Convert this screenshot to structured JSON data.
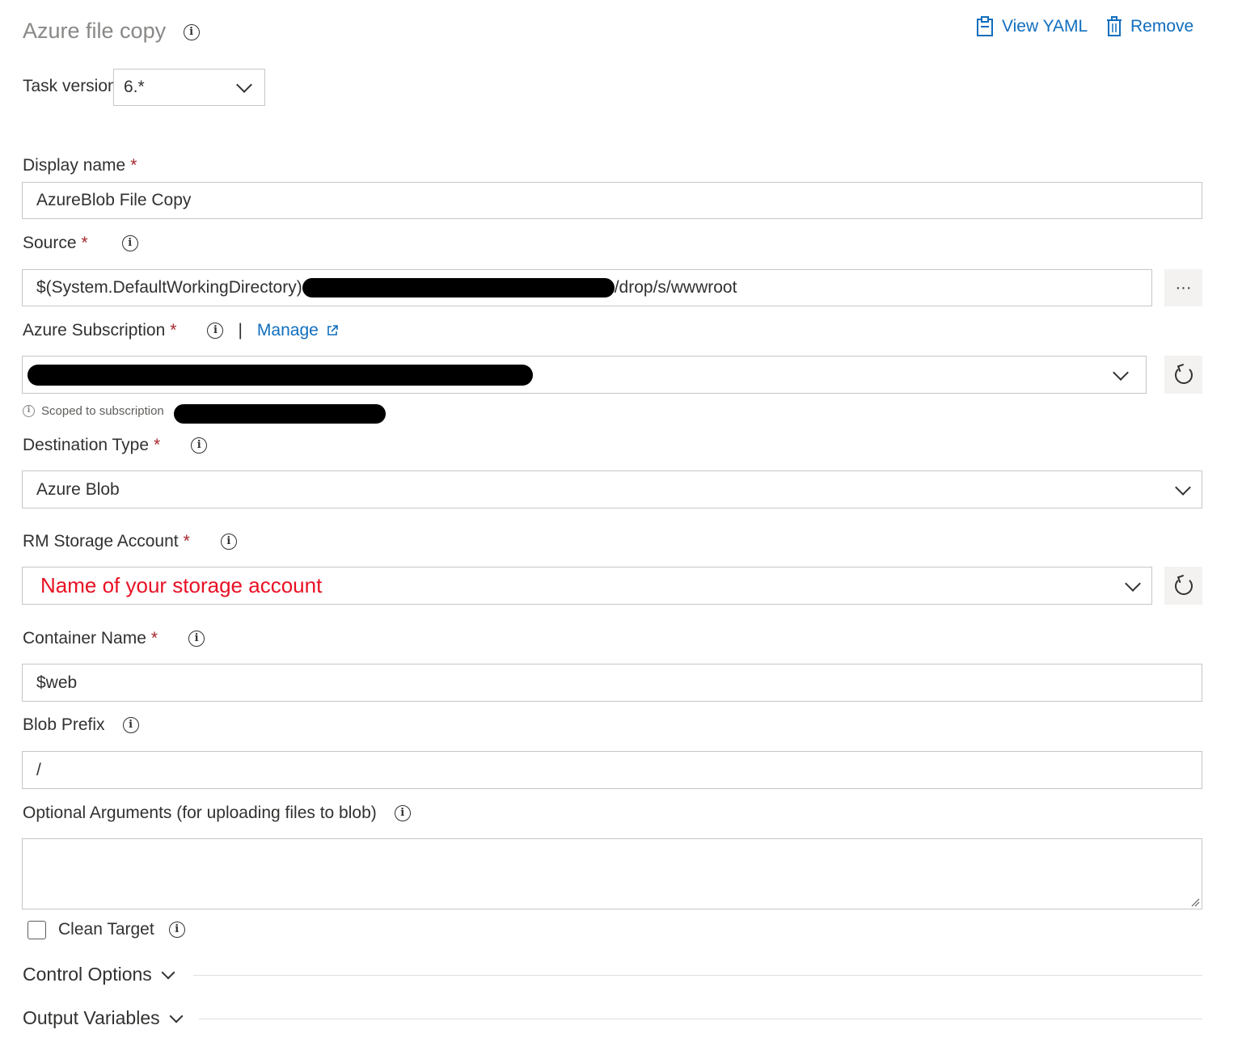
{
  "header": {
    "title": "Azure file copy",
    "view_yaml_label": "View YAML",
    "remove_label": "Remove"
  },
  "task_version": {
    "label": "Task version",
    "value": "6.*"
  },
  "display_name": {
    "label": "Display name",
    "value": "AzureBlob File Copy"
  },
  "source": {
    "label": "Source",
    "value_prefix": "$(System.DefaultWorkingDirectory)",
    "value_suffix": "/drop/s/wwwroot",
    "browse_label": "···"
  },
  "azure_subscription": {
    "label": "Azure Subscription",
    "manage_label": "Manage",
    "separator": "|",
    "scoped_note": "Scoped to subscription"
  },
  "destination_type": {
    "label": "Destination Type",
    "value": "Azure Blob"
  },
  "rm_storage_account": {
    "label": "RM Storage Account",
    "value": "Name of your storage account",
    "value_color": "#e81123"
  },
  "container_name": {
    "label": "Container Name",
    "value": "$web"
  },
  "blob_prefix": {
    "label": "Blob Prefix",
    "value": "/"
  },
  "optional_arguments": {
    "label": "Optional Arguments (for uploading files to blob)",
    "value": ""
  },
  "clean_target": {
    "label": "Clean Target",
    "checked": false
  },
  "sections": {
    "control_options": "Control Options",
    "output_variables": "Output Variables"
  },
  "colors": {
    "accent": "#106ebe",
    "required": "#a4262c",
    "border": "#c8c6c4"
  }
}
